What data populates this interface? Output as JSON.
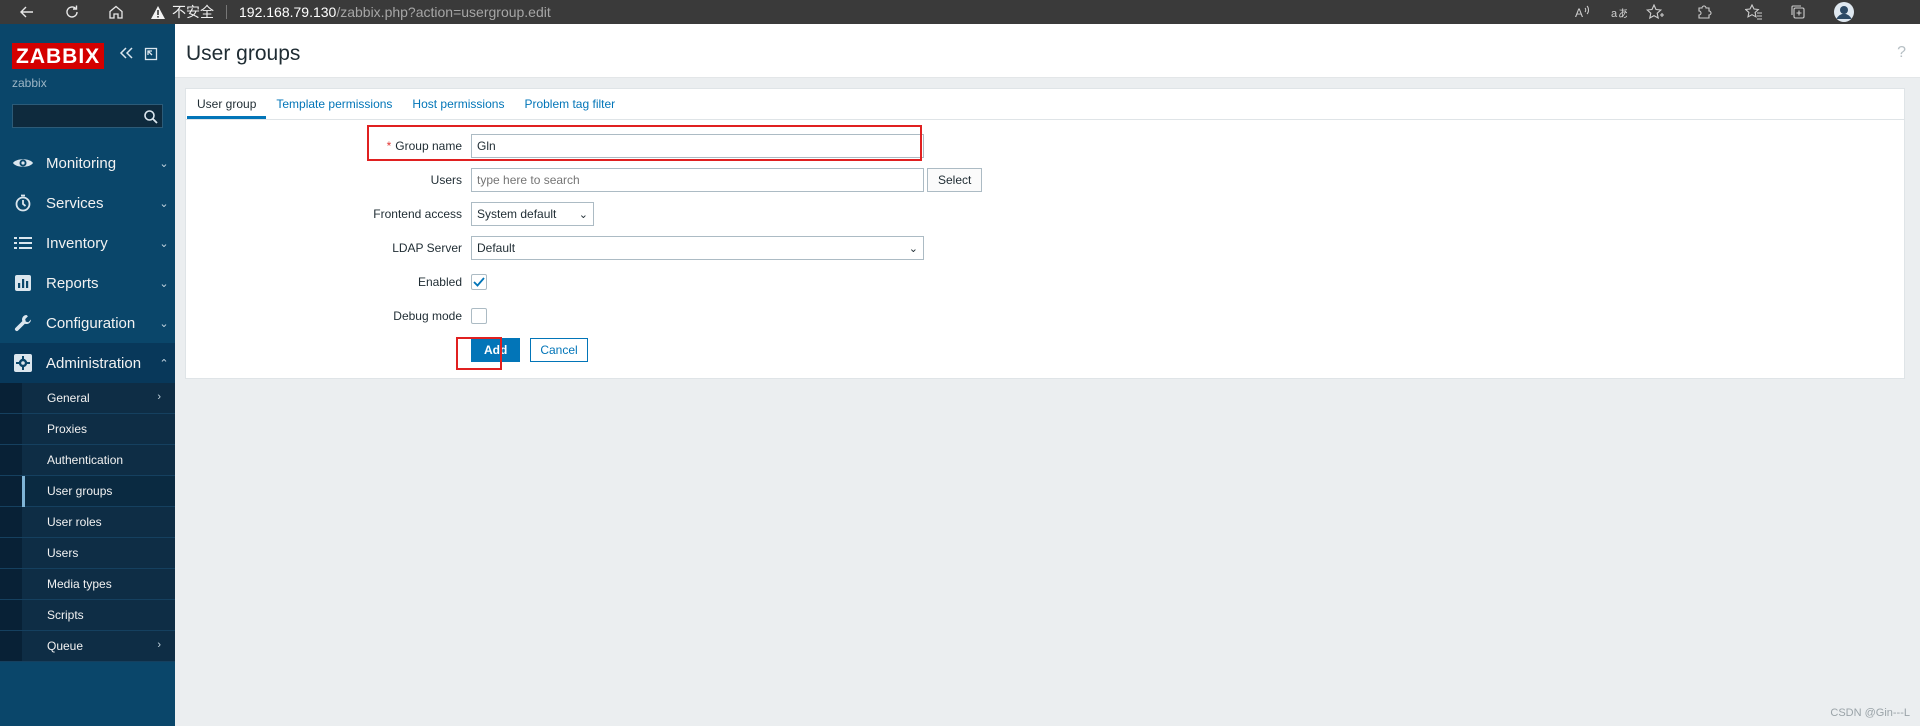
{
  "browser": {
    "security_label": "不安全",
    "url_host": "192.168.79.130",
    "url_path": "/zabbix.php?action=usergroup.edit",
    "icons": [
      "back-icon",
      "refresh-icon",
      "home-icon",
      "warning-icon",
      "read-aloud-icon",
      "translate-icon",
      "favorite-add-icon",
      "extensions-icon",
      "favorites-icon",
      "collections-icon",
      "profile-avatar"
    ]
  },
  "sidebar": {
    "logo": "ZABBIX",
    "server_name": "zabbix",
    "search_placeholder": "",
    "menu": [
      {
        "label": "Monitoring",
        "icon": "eye-icon",
        "expanded": false
      },
      {
        "label": "Services",
        "icon": "clock-icon",
        "expanded": false
      },
      {
        "label": "Inventory",
        "icon": "list-icon",
        "expanded": false
      },
      {
        "label": "Reports",
        "icon": "bar-chart-icon",
        "expanded": false
      },
      {
        "label": "Configuration",
        "icon": "wrench-icon",
        "expanded": false
      },
      {
        "label": "Administration",
        "icon": "gear-icon",
        "expanded": true
      }
    ],
    "admin_submenu": [
      {
        "label": "General",
        "has_arrow": true
      },
      {
        "label": "Proxies",
        "has_arrow": false
      },
      {
        "label": "Authentication",
        "has_arrow": false
      },
      {
        "label": "User groups",
        "has_arrow": false,
        "selected": true
      },
      {
        "label": "User roles",
        "has_arrow": false
      },
      {
        "label": "Users",
        "has_arrow": false
      },
      {
        "label": "Media types",
        "has_arrow": false
      },
      {
        "label": "Scripts",
        "has_arrow": false
      },
      {
        "label": "Queue",
        "has_arrow": true
      }
    ]
  },
  "page": {
    "title": "User groups",
    "help": "?"
  },
  "tabs": [
    {
      "label": "User group",
      "active": true
    },
    {
      "label": "Template permissions",
      "active": false
    },
    {
      "label": "Host permissions",
      "active": false
    },
    {
      "label": "Problem tag filter",
      "active": false
    }
  ],
  "form": {
    "group_name": {
      "label": "Group name",
      "required_mark": "*",
      "value": "Gln"
    },
    "users": {
      "label": "Users",
      "placeholder": "type here to search",
      "select_button": "Select"
    },
    "frontend_access": {
      "label": "Frontend access",
      "value": "System default"
    },
    "ldap_server": {
      "label": "LDAP Server",
      "value": "Default"
    },
    "enabled": {
      "label": "Enabled",
      "checked": true
    },
    "debug_mode": {
      "label": "Debug mode",
      "checked": false
    },
    "add_button": "Add",
    "cancel_button": "Cancel"
  },
  "watermark": "CSDN @Gin---L",
  "colors": {
    "sidebar_bg": "#0a466a",
    "logo_red": "#d40000",
    "accent_blue": "#0275b8",
    "highlight_red": "#e02020",
    "page_bg": "#ebeef0"
  }
}
